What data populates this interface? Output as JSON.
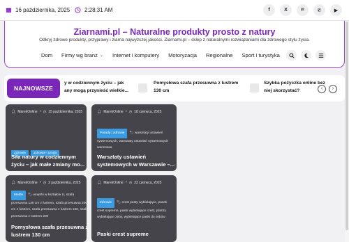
{
  "topbar": {
    "date": "16 października, 2025",
    "time": "2:28:31 AM",
    "social": [
      "facebook-icon",
      "x-twitter-icon",
      "pinterest-icon",
      "whatsapp-icon",
      "youtube-icon"
    ]
  },
  "header": {
    "title": "Ziarnami.pl – Naturalne produkty prosto z natury",
    "description": "Odkryj zdrowe produkty, przyprawy i ziarna najwyższej jakości. Ziarnami.pl – sklep z naturalnymi rozwiązaniami dla zdrowego stylu życia.",
    "nav": [
      "Dom",
      "Firmy wg branż",
      "Internet i komputery",
      "Motoryzacja",
      "Regionalne",
      "Sport i turystyka"
    ]
  },
  "ticker": {
    "label": "NAJNOWSZE",
    "items": [
      {
        "line1": "y w codziennym życiu – jak",
        "line2": "any mogą przynieść wielkie..."
      },
      {
        "line1": "Pomysłowa szafa przesuwna z lustrem",
        "line2": "130 cm"
      },
      {
        "line1": "Szybka pożyczka online bez",
        "line2": "niej skorzystać?"
      }
    ]
  },
  "cards": [
    {
      "author": "MarekOnline",
      "date": "15 października, 2025",
      "categories": [
        "Zdrowie",
        "Zdrowie i uroda"
      ],
      "title": "Siła natury w codziennym życiu – jak małe zmiany mo..."
    },
    {
      "author": "MarekOnline",
      "date": "18 czerwca, 2025",
      "categories": [
        "Porady i zdrowie"
      ],
      "tags": "warsztaty ustawień systemowych, warsztaty ustawień systemowych warszawa",
      "title": "Warsztaty ustawień systemowych w Warszawie –..."
    },
    {
      "author": "MarekOnline",
      "date": "2 października, 2025",
      "categories": [
        "Meble"
      ],
      "tags": "szafa przesuwna 130 cm z lustrem, szafa przesuwna 200 cm z lustrem, szafa przesuwna z lustrem 150, szafa przesuwna z lustrem 200",
      "tag_lead": "wnętrki w kształcie U,",
      "title": "Pomysłowa szafa przesuwna z lustrem 130 cm"
    },
    {
      "author": "MarekOnline",
      "date": "23 czerwca, 2025",
      "categories": [
        "Zdrowie"
      ],
      "tag_lead": "crest pasty wybielające,",
      "tags": "pasek crest supreme, paski wybielające crest, plastry wybielające zęby, wybielające paski do zębów",
      "title": "Paski crest supreme"
    }
  ],
  "colors": {
    "accent": "#7a27b9",
    "card_bg": "#45444b",
    "pill": "#3b9be0"
  }
}
